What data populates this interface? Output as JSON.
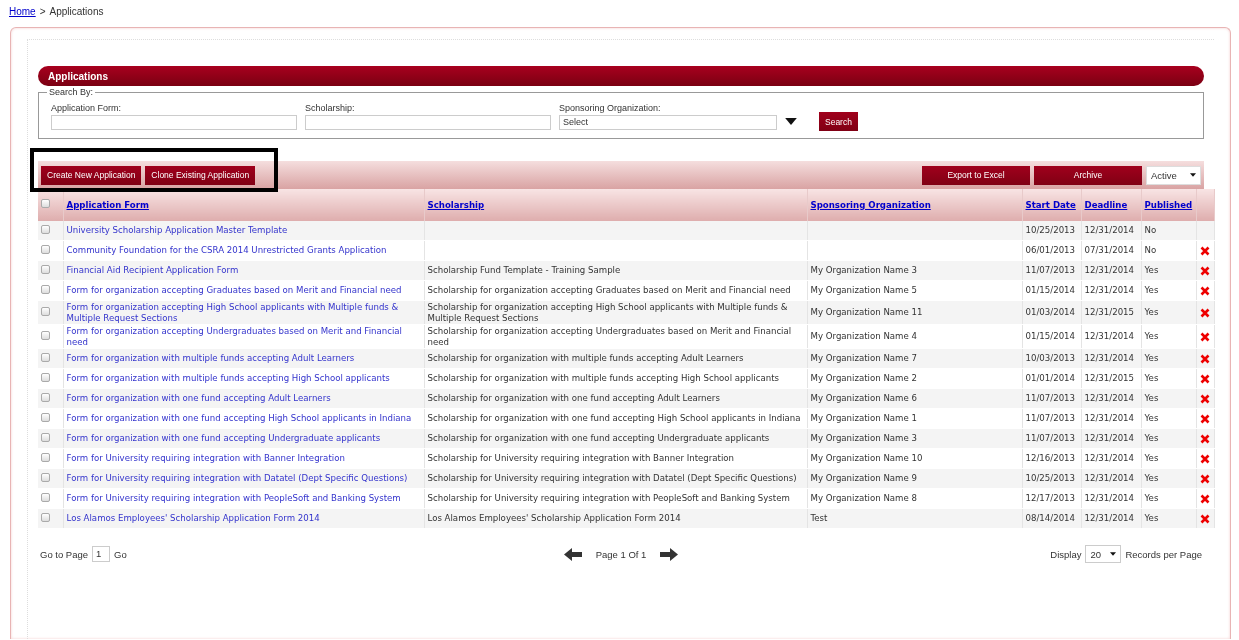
{
  "breadcrumb": {
    "link": "Home",
    "separator": ">",
    "current": "Applications"
  },
  "panel_title": "Applications",
  "search": {
    "legend": "Search By:",
    "fields": [
      {
        "kind": "text",
        "label": "Application Form:"
      },
      {
        "kind": "text",
        "label": "Scholarship:"
      },
      {
        "kind": "select",
        "label": "Sponsoring Organization:",
        "value": "Select"
      }
    ],
    "button": "Search"
  },
  "toolbar": {
    "left_buttons": [
      "Create New Application",
      "Clone Existing Application"
    ],
    "highlighted": true,
    "right_buttons": [
      "Export to Excel",
      "Archive"
    ],
    "status_filter": "Active"
  },
  "table": {
    "select_all": {
      "checked": false
    },
    "columns": [
      "Application Form",
      "Scholarship",
      "Sponsoring Organization",
      "Start Date",
      "Deadline",
      "Published"
    ],
    "rows": [
      {
        "checked": false,
        "form": "University Scholarship Application Master Template",
        "start": "10/25/2013",
        "deadline": "12/31/2014",
        "published": "No",
        "deletable": false
      },
      {
        "checked": false,
        "form": "Community Foundation for the CSRA 2014 Unrestricted Grants Application",
        "start": "06/01/2013",
        "deadline": "07/31/2014",
        "published": "No",
        "deletable": true
      },
      {
        "checked": false,
        "form": "Financial Aid Recipient Application Form",
        "scholarship": "Scholarship Fund Template - Training Sample",
        "organization": "My Organization Name 3",
        "start": "11/07/2013",
        "deadline": "12/31/2014",
        "published": "Yes",
        "deletable": true
      },
      {
        "checked": false,
        "form": "Form for organization accepting Graduates based on Merit and Financial need",
        "scholarship": "Scholarship for organization accepting Graduates based on Merit and Financial need",
        "organization": "My Organization Name 5",
        "start": "01/15/2014",
        "deadline": "12/31/2014",
        "published": "Yes",
        "deletable": true
      },
      {
        "checked": false,
        "form": "Form for organization accepting High School applicants with Multiple funds & Multiple Request Sections",
        "scholarship": "Scholarship for organization accepting High School applicants with Multiple funds & Multiple Request Sections",
        "organization": "My Organization Name 11",
        "start": "01/03/2014",
        "deadline": "12/31/2015",
        "published": "Yes",
        "deletable": true
      },
      {
        "checked": false,
        "form": "Form for organization accepting Undergraduates based on Merit and Financial need",
        "scholarship": "Scholarship for organization accepting Undergraduates based on Merit and Financial need",
        "organization": "My Organization Name 4",
        "start": "01/15/2014",
        "deadline": "12/31/2014",
        "published": "Yes",
        "deletable": true
      },
      {
        "checked": false,
        "form": "Form for organization with multiple funds accepting Adult Learners",
        "scholarship": "Scholarship for organization with multiple funds accepting Adult Learners",
        "organization": "My Organization Name 7",
        "start": "10/03/2013",
        "deadline": "12/31/2014",
        "published": "Yes",
        "deletable": true
      },
      {
        "checked": false,
        "form": "Form for organization with multiple funds accepting High School applicants",
        "scholarship": "Scholarship for organization with multiple funds accepting High School applicants",
        "organization": "My Organization Name 2",
        "start": "01/01/2014",
        "deadline": "12/31/2015",
        "published": "Yes",
        "deletable": true
      },
      {
        "checked": false,
        "form": "Form for organization with one fund accepting Adult Learners",
        "scholarship": "Scholarship for organization with one fund accepting Adult Learners",
        "organization": "My Organization Name 6",
        "start": "11/07/2013",
        "deadline": "12/31/2014",
        "published": "Yes",
        "deletable": true
      },
      {
        "checked": false,
        "form": "Form for organization with one fund accepting High School applicants in Indiana",
        "scholarship": "Scholarship for organization with one fund accepting High School applicants in Indiana",
        "organization": "My Organization Name 1",
        "start": "11/07/2013",
        "deadline": "12/31/2014",
        "published": "Yes",
        "deletable": true
      },
      {
        "checked": false,
        "form": "Form for organization with one fund accepting Undergraduate applicants",
        "scholarship": "Scholarship for organization with one fund accepting Undergraduate applicants",
        "organization": "My Organization Name 3",
        "start": "11/07/2013",
        "deadline": "12/31/2014",
        "published": "Yes",
        "deletable": true
      },
      {
        "checked": false,
        "form": "Form for University requiring integration with Banner Integration",
        "scholarship": "Scholarship for University requiring integration with Banner Integration",
        "organization": "My Organization Name 10",
        "start": "12/16/2013",
        "deadline": "12/31/2014",
        "published": "Yes",
        "deletable": true
      },
      {
        "checked": false,
        "form": "Form for University requiring integration with Datatel (Dept Specific Questions)",
        "scholarship": "Scholarship for University requiring integration with Datatel (Dept Specific Questions)",
        "organization": "My Organization Name 9",
        "start": "10/25/2013",
        "deadline": "12/31/2014",
        "published": "Yes",
        "deletable": true
      },
      {
        "checked": false,
        "form": "Form for University requiring integration with PeopleSoft and Banking System",
        "scholarship": "Scholarship for University requiring integration with PeopleSoft and Banking System",
        "organization": "My Organization Name 8",
        "start": "12/17/2013",
        "deadline": "12/31/2014",
        "published": "Yes",
        "deletable": true
      },
      {
        "checked": false,
        "form": "Los Alamos Employees' Scholarship Application Form 2014",
        "scholarship": "Los Alamos Employees' Scholarship Application Form 2014",
        "organization": "Test",
        "start": "08/14/2014",
        "deadline": "12/31/2014",
        "published": "Yes",
        "deletable": true
      }
    ]
  },
  "footer": {
    "goto_label": "Go to Page",
    "page_input": "1",
    "go": "Go",
    "page_info": "Page 1 Of 1",
    "display_label": "Display",
    "page_size": "20",
    "records_label": "Records per Page"
  }
}
